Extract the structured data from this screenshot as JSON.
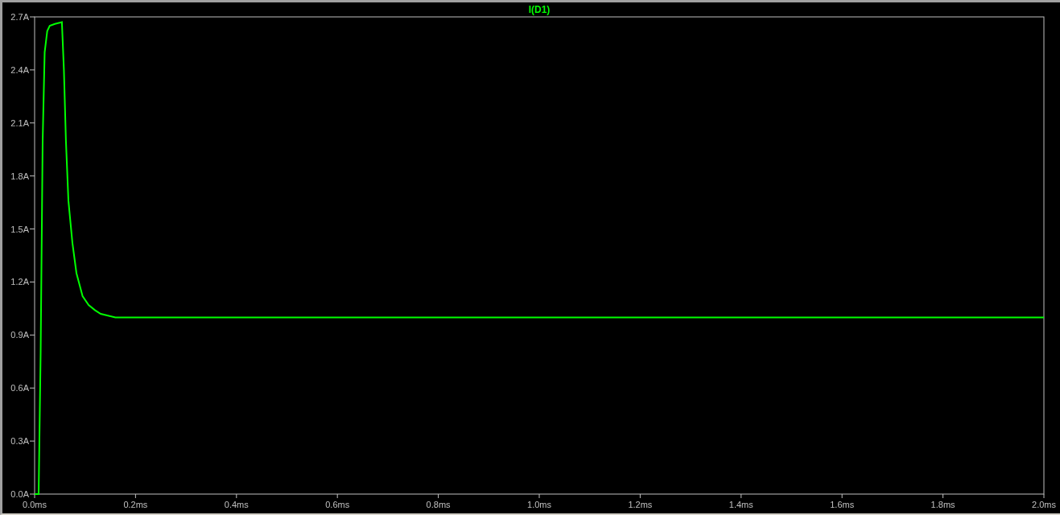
{
  "chart_data": {
    "type": "line",
    "x": [
      0,
      0.008,
      0.012,
      0.016,
      0.02,
      0.025,
      0.03,
      0.04,
      0.054,
      0.058,
      0.062,
      0.067,
      0.075,
      0.083,
      0.095,
      0.107,
      0.12,
      0.131,
      0.16,
      0.3,
      0.6,
      1.0,
      1.4,
      1.8,
      2.0
    ],
    "series": [
      {
        "name": "I(D1)",
        "color": "#00ff00",
        "values": [
          0,
          0,
          0.8,
          2.0,
          2.5,
          2.62,
          2.65,
          2.66,
          2.67,
          2.4,
          2.0,
          1.66,
          1.42,
          1.25,
          1.12,
          1.07,
          1.04,
          1.02,
          1.0,
          1.0,
          1.0,
          1.0,
          1.0,
          1.0,
          1.0
        ]
      }
    ],
    "xlim": [
      0,
      2.0
    ],
    "ylim": [
      0,
      2.7
    ],
    "xticks": [
      {
        "value": 0,
        "label": "0.0ms"
      },
      {
        "value": 0.2,
        "label": "0.2ms"
      },
      {
        "value": 0.4,
        "label": "0.4ms"
      },
      {
        "value": 0.6,
        "label": "0.6ms"
      },
      {
        "value": 0.8,
        "label": "0.8ms"
      },
      {
        "value": 1.0,
        "label": "1.0ms"
      },
      {
        "value": 1.2,
        "label": "1.2ms"
      },
      {
        "value": 1.4,
        "label": "1.4ms"
      },
      {
        "value": 1.6,
        "label": "1.6ms"
      },
      {
        "value": 1.8,
        "label": "1.8ms"
      },
      {
        "value": 2.0,
        "label": "2.0ms"
      }
    ],
    "yticks": [
      {
        "value": 0,
        "label": "0.0A"
      },
      {
        "value": 0.3,
        "label": "0.3A"
      },
      {
        "value": 0.6,
        "label": "0.6A"
      },
      {
        "value": 0.9,
        "label": "0.9A"
      },
      {
        "value": 1.2,
        "label": "1.2A"
      },
      {
        "value": 1.5,
        "label": "1.5A"
      },
      {
        "value": 1.8,
        "label": "1.8A"
      },
      {
        "value": 2.1,
        "label": "2.1A"
      },
      {
        "value": 2.4,
        "label": "2.4A"
      },
      {
        "value": 2.7,
        "label": "2.7A"
      }
    ]
  }
}
